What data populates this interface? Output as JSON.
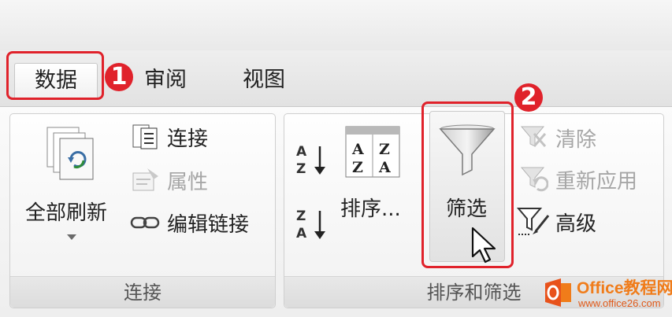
{
  "tabs": [
    {
      "label": "数据",
      "active": true
    },
    {
      "label": "审阅",
      "active": false
    },
    {
      "label": "视图",
      "active": false
    }
  ],
  "groups": {
    "connections": {
      "label": "连接",
      "refresh_all": "全部刷新",
      "connections_btn": "连接",
      "properties_btn": "属性",
      "edit_links_btn": "编辑链接"
    },
    "sort_filter": {
      "label": "排序和筛选",
      "sort_btn": "排序...",
      "filter_btn": "筛选",
      "clear_btn": "清除",
      "reapply_btn": "重新应用",
      "advanced_btn": "高级"
    }
  },
  "annotations": [
    {
      "number": "1"
    },
    {
      "number": "2"
    }
  ],
  "watermark": {
    "line1": "Office教程网",
    "line2": "www.office26.com"
  },
  "colors": {
    "highlight": "#e0222b",
    "watermark": "#f07c1a"
  },
  "icons": [
    "refresh-all-icon",
    "connections-icon",
    "properties-icon",
    "edit-links-icon",
    "sort-asc-icon",
    "sort-desc-icon",
    "sort-dialog-icon",
    "filter-funnel-icon",
    "clear-icon",
    "reapply-icon",
    "advanced-icon",
    "mouse-cursor-icon"
  ]
}
